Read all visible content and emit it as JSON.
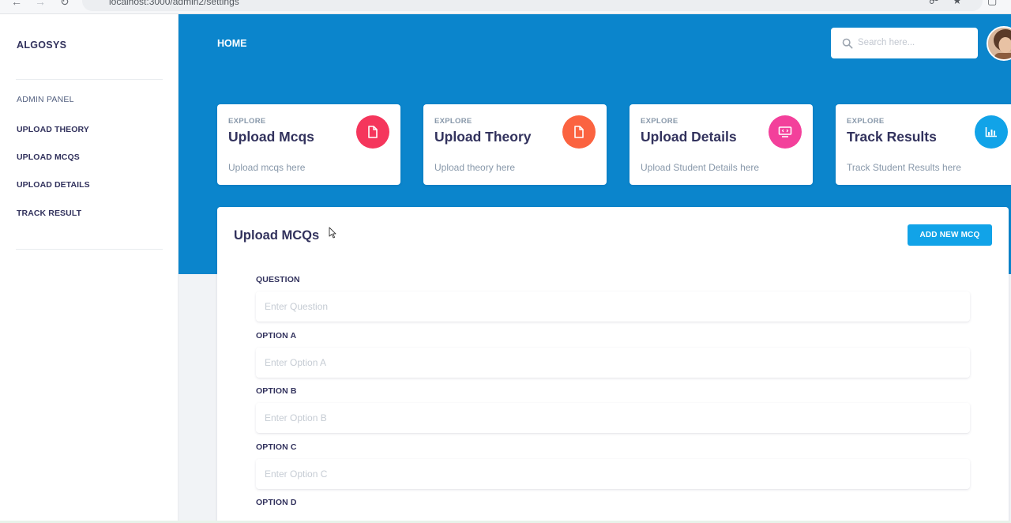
{
  "browser": {
    "url": "localhost:3000/admin2/settings",
    "back_icon": "arrow-left-icon",
    "forward_icon": "arrow-right-icon",
    "reload_icon": "reload-icon"
  },
  "sidebar": {
    "brand": "ALGOSYS",
    "heading": "ADMIN PANEL",
    "items": [
      {
        "label": "UPLOAD THEORY"
      },
      {
        "label": "UPLOAD MCQS"
      },
      {
        "label": "UPLOAD DETAILS"
      },
      {
        "label": "TRACK RESULT"
      }
    ]
  },
  "header": {
    "home_label": "HOME",
    "search": {
      "placeholder": "Search here...",
      "value": ""
    },
    "accent_color": "#0b85cc"
  },
  "cards": [
    {
      "explore": "EXPLORE",
      "title": "Upload Mcqs",
      "subtitle": "Upload mcqs here",
      "icon": "document-icon",
      "color": "#f5365c"
    },
    {
      "explore": "EXPLORE",
      "title": "Upload Theory",
      "subtitle": "Upload theory here",
      "icon": "document-icon",
      "color": "#fb6340"
    },
    {
      "explore": "EXPLORE",
      "title": "Upload Details",
      "subtitle": "Upload Student Details here",
      "icon": "monitor-icon",
      "color": "#f3409b"
    },
    {
      "explore": "EXPLORE",
      "title": "Track Results",
      "subtitle": "Track Student Results here",
      "icon": "bar-chart-icon",
      "color": "#11a3e8"
    }
  ],
  "panel": {
    "title": "Upload MCQs",
    "add_button_label": "ADD NEW MCQ",
    "fields": [
      {
        "label": "QUESTION",
        "placeholder": "Enter Question",
        "value": ""
      },
      {
        "label": "OPTION A",
        "placeholder": "Enter Option A",
        "value": ""
      },
      {
        "label": "OPTION B",
        "placeholder": "Enter Option B",
        "value": ""
      },
      {
        "label": "OPTION C",
        "placeholder": "Enter Option C",
        "value": ""
      },
      {
        "label": "OPTION D",
        "placeholder": "",
        "value": ""
      }
    ]
  }
}
